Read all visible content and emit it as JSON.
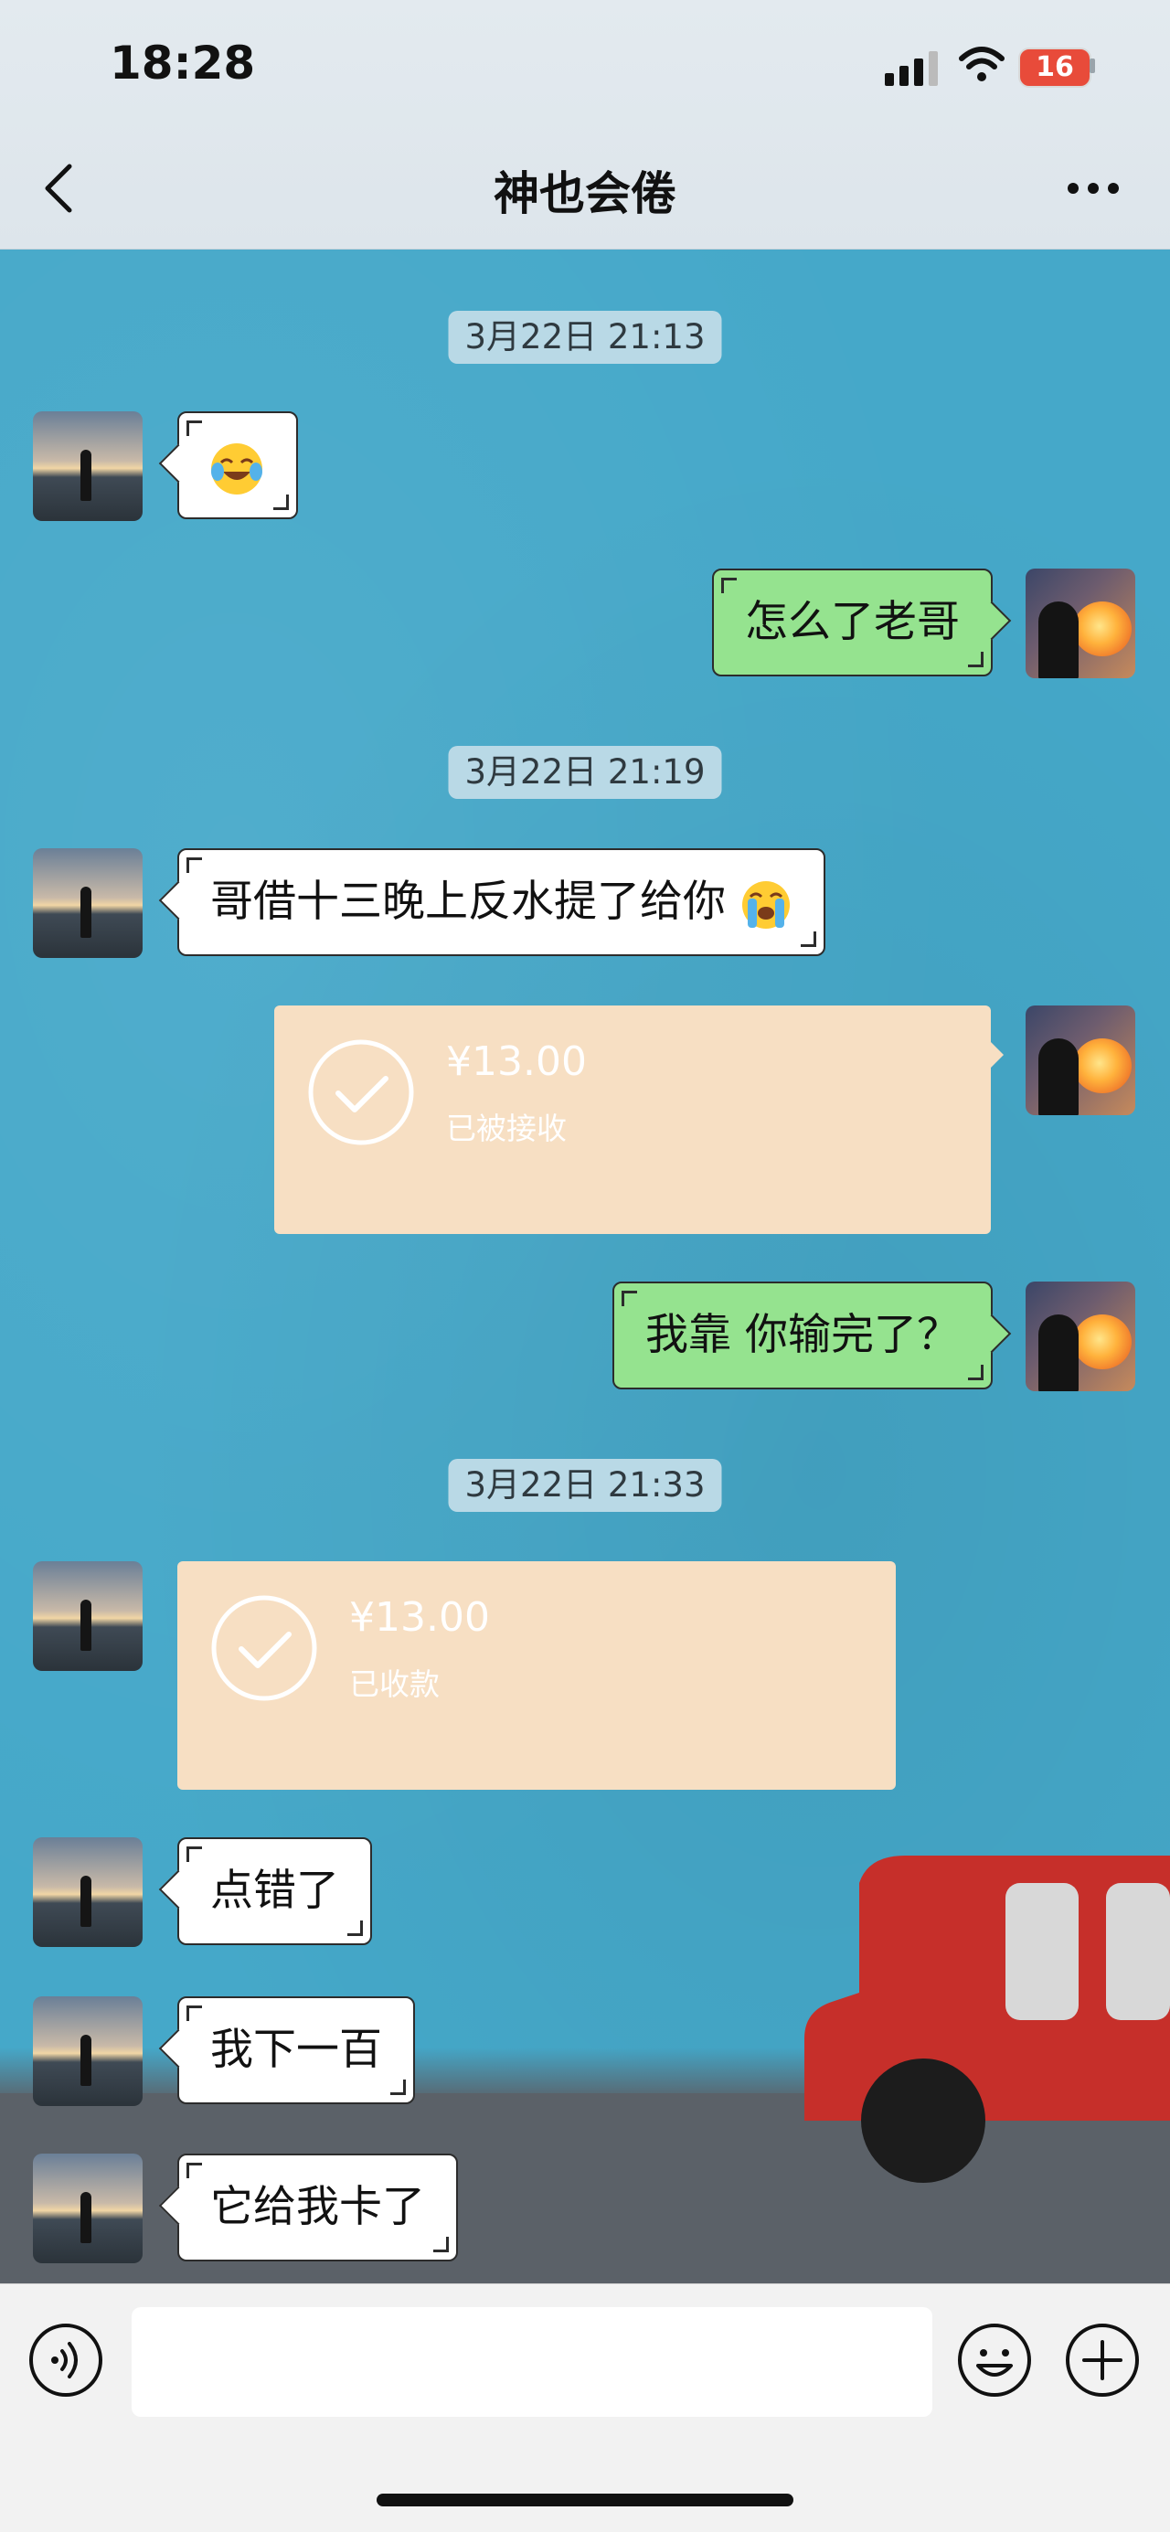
{
  "status_bar": {
    "time": "18:28",
    "battery": "16"
  },
  "header": {
    "title": "神也会倦"
  },
  "messages": [
    {
      "type": "timestamp",
      "text": "3月22日 21:13"
    },
    {
      "type": "emoji",
      "from": "other",
      "emoji": "laughing-crying-face-icon"
    },
    {
      "type": "text",
      "from": "me",
      "text": "怎么了老哥"
    },
    {
      "type": "timestamp",
      "text": "3月22日 21:19"
    },
    {
      "type": "text",
      "from": "other",
      "text": "哥借十三晚上反水提了给你"
    },
    {
      "type": "transfer",
      "from": "me",
      "amount": "¥13.00",
      "status": "已被接收"
    },
    {
      "type": "text",
      "from": "me",
      "text": "我靠 你输完了？"
    },
    {
      "type": "timestamp",
      "text": "3月22日 21:33"
    },
    {
      "type": "transfer",
      "from": "other",
      "amount": "¥13.00",
      "status": "已收款"
    },
    {
      "type": "text",
      "from": "other",
      "text": "点错了"
    },
    {
      "type": "text",
      "from": "other",
      "text": "我下一百"
    },
    {
      "type": "text",
      "from": "other",
      "text": "它给我卡了"
    }
  ],
  "input": {
    "value": ""
  },
  "colors": {
    "chat_bg": "#45a8c9",
    "my_bubble": "#95e38f",
    "other_bubble": "#ffffff",
    "transfer_card": "#f7dfc3"
  }
}
